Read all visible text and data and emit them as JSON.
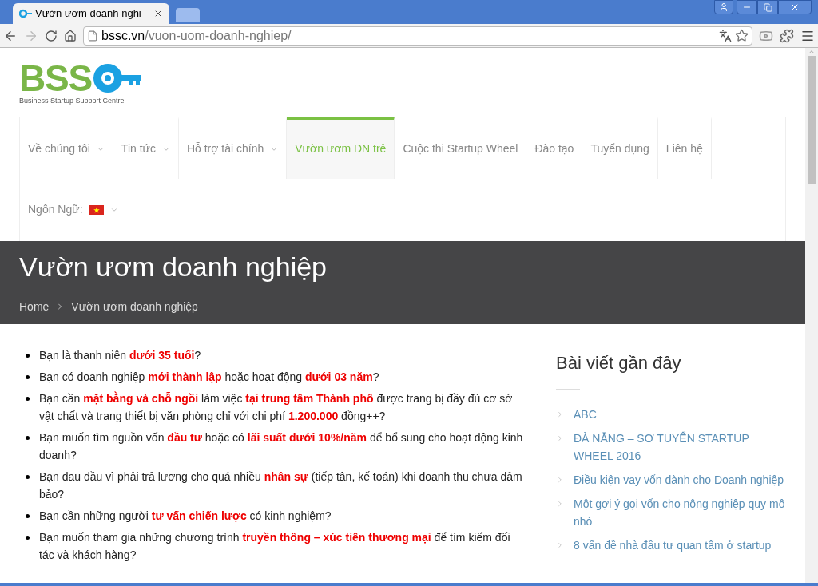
{
  "browser": {
    "tab_title": "Vườn ươm doanh nghi",
    "url_host": "bssc.vn",
    "url_path": "/vuon-uom-doanh-nghiep/"
  },
  "logo": {
    "letters": "BSS",
    "tagline": "Business Startup Support Centre"
  },
  "nav": [
    {
      "label": "Về chúng tôi",
      "dropdown": true,
      "selected": false
    },
    {
      "label": "Tin tức",
      "dropdown": true,
      "selected": false
    },
    {
      "label": "Hỗ trợ tài chính",
      "dropdown": true,
      "selected": false
    },
    {
      "label": "Vườn ươm DN trẻ",
      "dropdown": false,
      "selected": true
    },
    {
      "label": "Cuộc thi Startup Wheel",
      "dropdown": false,
      "selected": false
    },
    {
      "label": "Đào tạo",
      "dropdown": false,
      "selected": false
    },
    {
      "label": "Tuyển dụng",
      "dropdown": false,
      "selected": false
    },
    {
      "label": "Liên hệ",
      "dropdown": false,
      "selected": false
    }
  ],
  "language": {
    "label": "Ngôn Ngữ:"
  },
  "banner": {
    "title": "Vườn ươm doanh nghiệp",
    "breadcrumb": [
      "Home",
      "Vườn ươm doanh nghiệp"
    ]
  },
  "bullets": [
    "Bạn là thanh niên **dưới 35 tuổi**?",
    "Bạn có doanh nghiệp **mới thành lập** hoặc hoạt động **dưới 03 năm**?",
    "Bạn cần **mặt bằng và chỗ ngồi** làm việc **tại trung tâm Thành phố** được trang bị đầy đủ cơ sở vật chất và trang thiết bị văn phòng chỉ với chi phí **1.200.000** đồng++?",
    "Bạn muốn tìm nguồn vốn **đầu tư** hoặc có **lãi suất dưới 10%/năm** để bổ sung cho hoạt động kinh doanh?",
    "Bạn đau đầu vì phải trả lương cho quá nhiều **nhân sự** (tiếp tân, kế toán) khi doanh thu chưa đảm bảo?",
    "Bạn cần những người **tư vấn chiến lược** có kinh nghiệm?",
    "Bạn muốn tham gia những chương trình **truyền thông – xúc tiến thương mại** để tìm kiếm đối tác và khách hàng?"
  ],
  "sidebar": {
    "title": "Bài viết gần đây",
    "items": [
      "ABC",
      "ĐÀ NẴNG – SƠ TUYỂN STARTUP WHEEL 2016",
      "Điều kiện vay vốn dành cho Doanh nghiệp",
      "Một gợi ý gọi vốn cho nông nghiệp quy mô nhỏ",
      "8 vấn đề nhà đầu tư quan tâm ở startup"
    ]
  }
}
